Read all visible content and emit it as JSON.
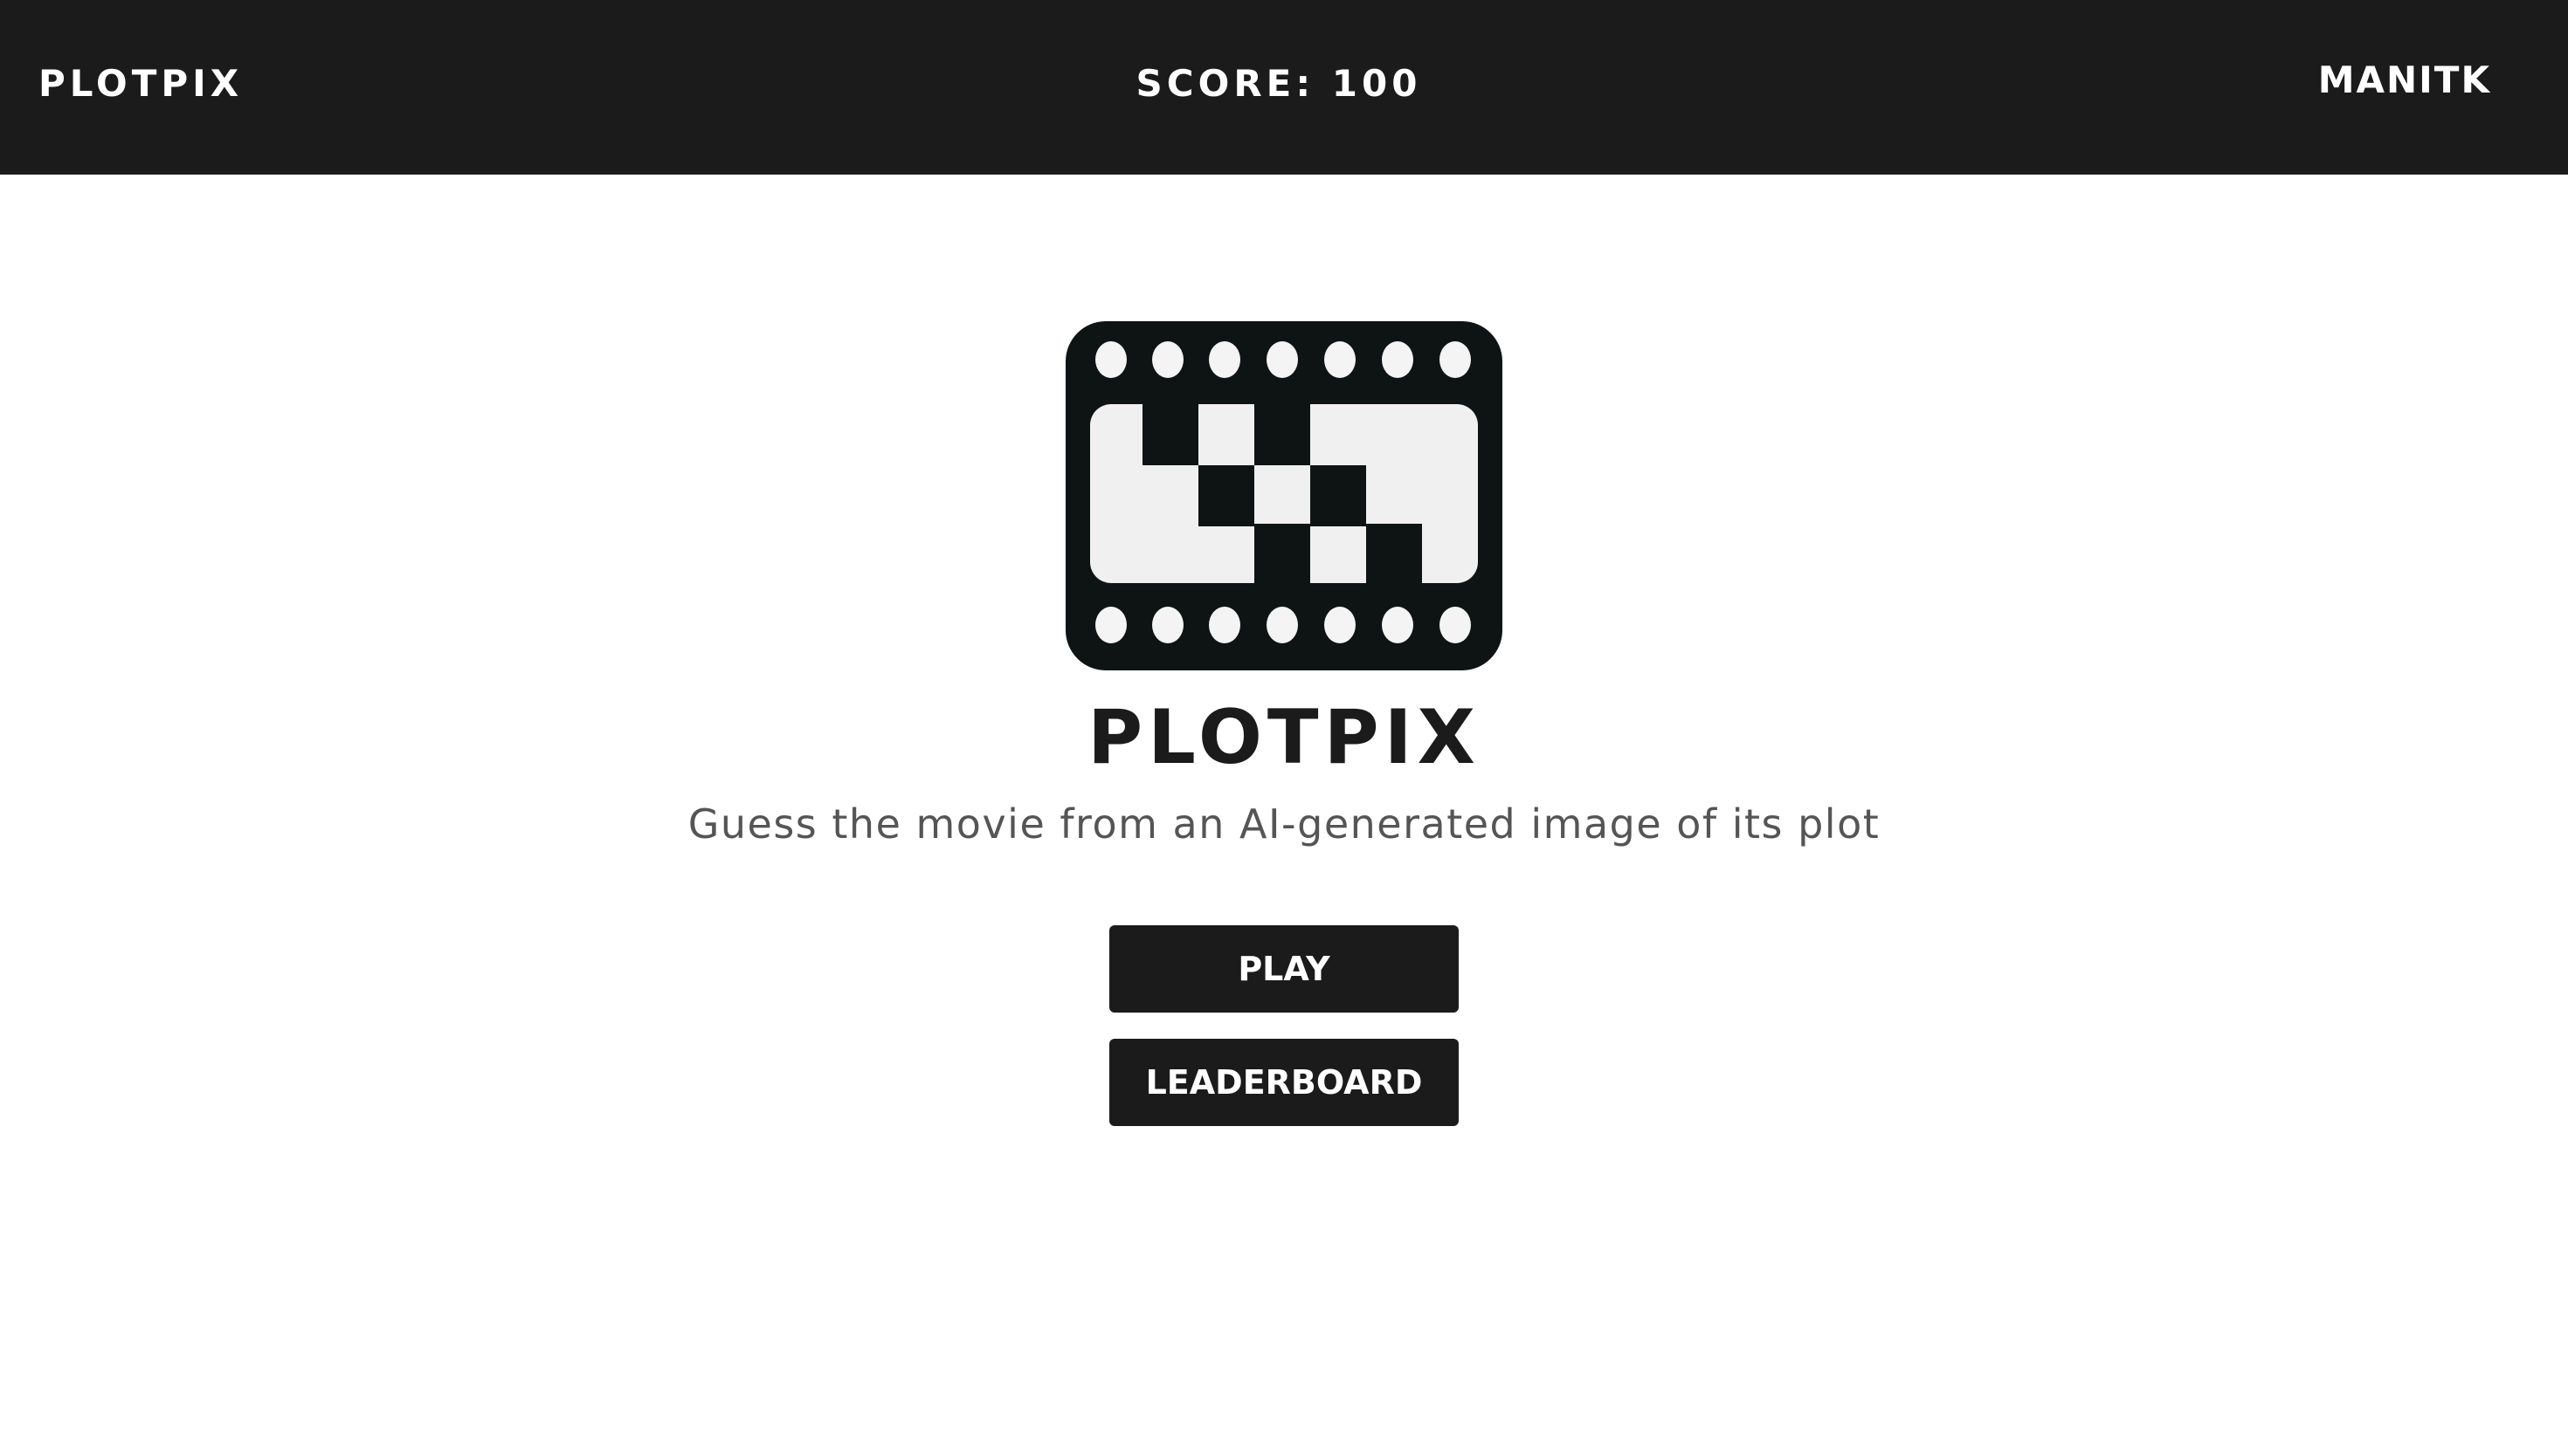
{
  "header": {
    "brand": "PLOTPIX",
    "score": "SCORE: 100",
    "user": "MANITK"
  },
  "hero": {
    "logo_icon": "film-strip-checkered-icon",
    "title": "PLOTPIX",
    "tagline": "Guess the movie from an AI-generated image of its plot"
  },
  "actions": {
    "play_label": "PLAY",
    "leaderboard_label": "LEADERBOARD"
  },
  "colors": {
    "bar": "#1b1b1b",
    "background": "#ffffff",
    "tagline": "#555555"
  }
}
